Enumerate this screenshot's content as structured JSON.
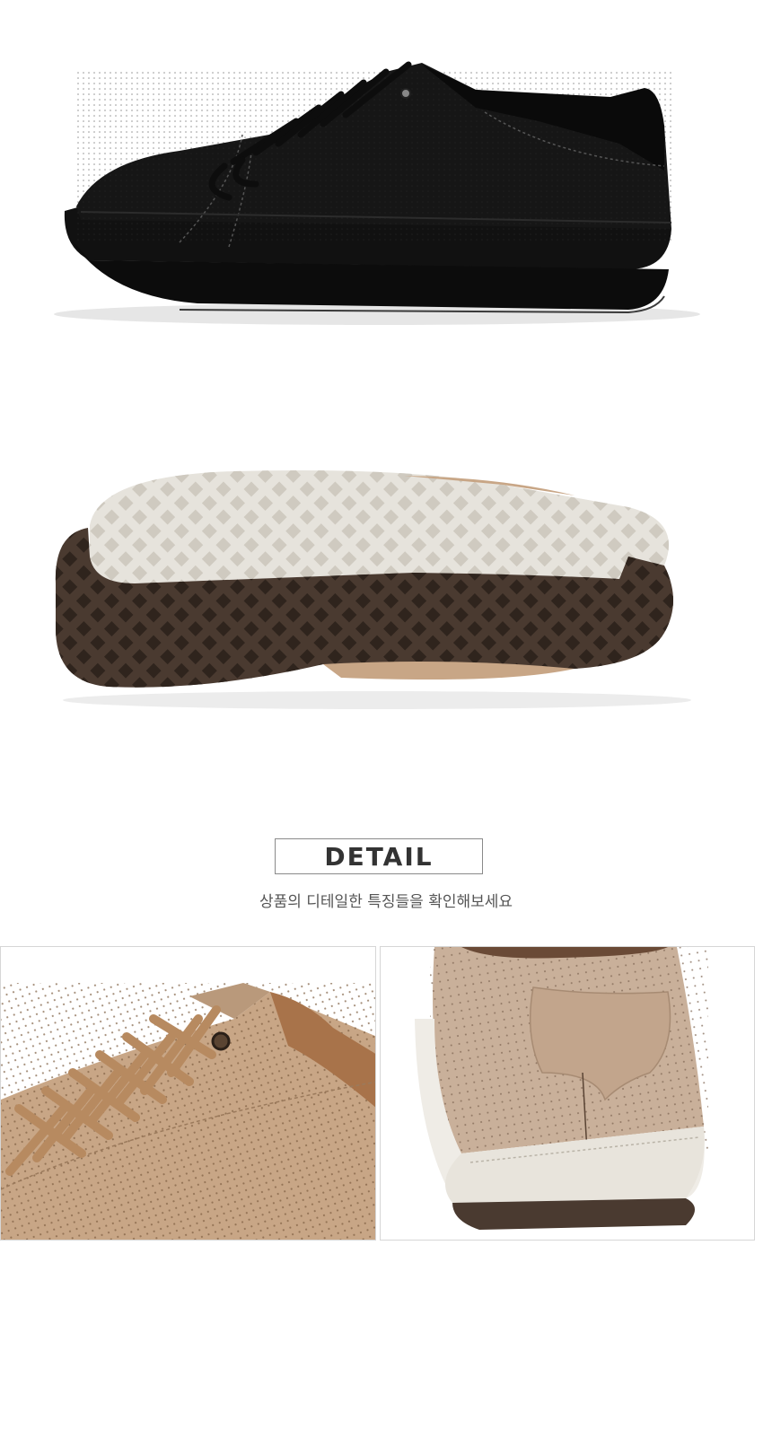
{
  "detail": {
    "title": "DETAIL",
    "subtitle": "상품의 디테일한 특징들을 확인해보세요"
  },
  "colors": {
    "black_upper": "#161616",
    "outsole_cream": "#e6e3dc",
    "outsole_brown": "#4a3a30",
    "tan_upper": "#c8a686",
    "tan_laces": "#b78a60",
    "heel_beige": "#c9b09a"
  }
}
